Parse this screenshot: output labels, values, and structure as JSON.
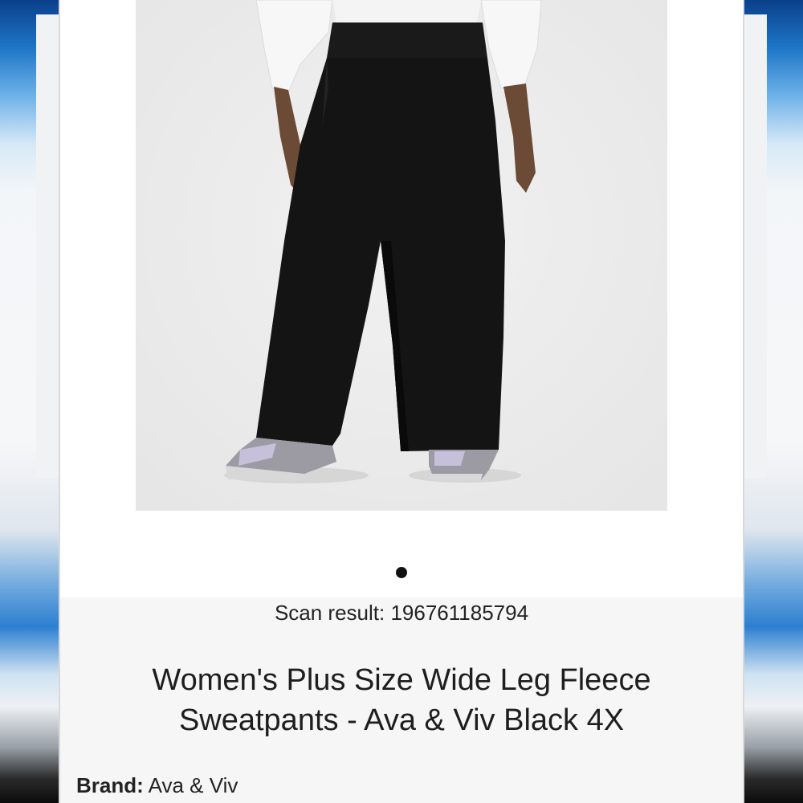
{
  "product": {
    "image_alt": "Model wearing black wide leg fleece sweatpants with white long-sleeve top and lavender sneakers",
    "carousel": {
      "count": 1,
      "active_index": 0
    },
    "scan_label": "Scan result:",
    "scan_value": "196761185794",
    "title_line1": "Women's Plus Size Wide Leg Fleece",
    "title_line2": "Sweatpants - Ava & Viv Black 4X",
    "brand_label": "Brand:",
    "brand_value": "Ava & Viv"
  },
  "colors": {
    "background": "#ffffff",
    "photo_bg": "#ececec",
    "info_bg": "#f6f6f6",
    "text": "#1e1e1e",
    "dot_active": "#111111"
  }
}
